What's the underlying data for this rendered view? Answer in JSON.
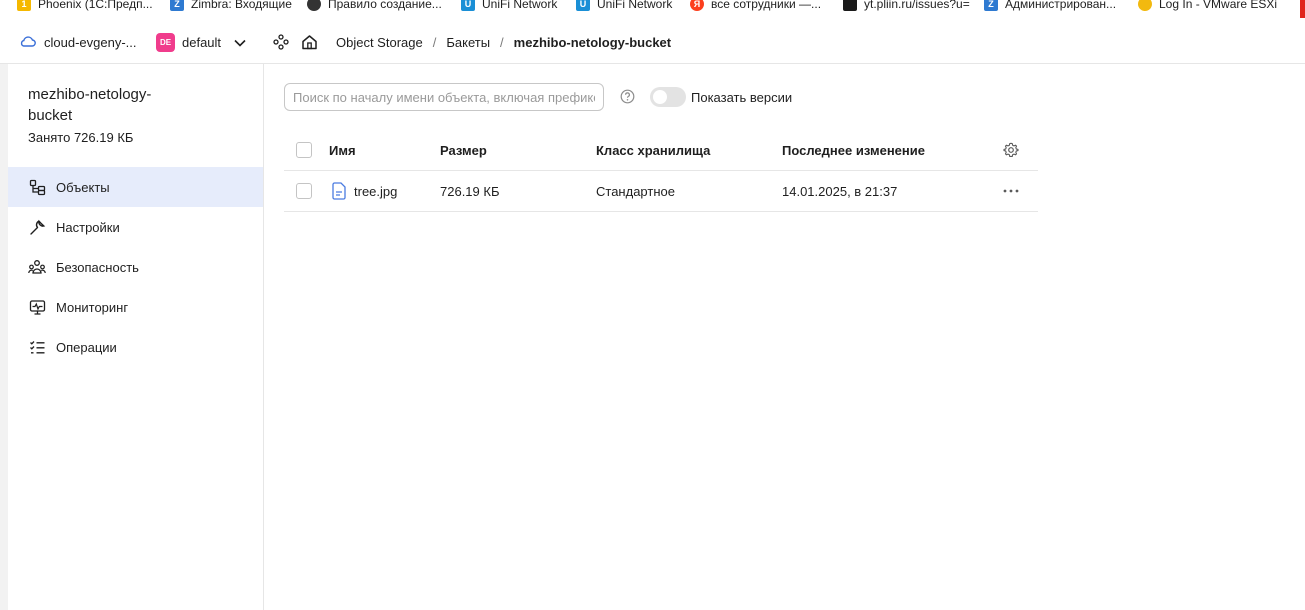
{
  "bookmarks": [
    {
      "label": "Phoenix (1С:Предп...",
      "icon": "1c-icon",
      "color": "#f5b800"
    },
    {
      "label": "Zimbra: Входящие",
      "icon": "zimbra-icon",
      "color": "#2e7ad1"
    },
    {
      "label": "Правило создание...",
      "icon": "globe-icon",
      "color": "#333333"
    },
    {
      "label": "UniFi Network",
      "icon": "unifi-icon",
      "color": "#1a8fd6"
    },
    {
      "label": "UniFi Network",
      "icon": "unifi-icon",
      "color": "#1a8fd6"
    },
    {
      "label": "все сотрудники —...",
      "icon": "yandex-icon",
      "color": "#fc3f1d"
    },
    {
      "label": "yt.pliin.ru/issues?u=",
      "icon": "youtrack-icon",
      "color": "#1a1a1a"
    },
    {
      "label": "Администрирован...",
      "icon": "zimbra-icon",
      "color": "#2e7ad1"
    },
    {
      "label": "Log In - VMware ESXi",
      "icon": "key-icon",
      "color": "#f2b90f"
    }
  ],
  "topbar": {
    "cloud": "cloud-evgeny-...",
    "folder_badge": "DE",
    "folder": "default",
    "breadcrumbs": [
      "Object Storage",
      "Бакеты",
      "mezhibo-netology-bucket"
    ]
  },
  "sidebar": {
    "bucket_name": "mezhibo-netology-bucket",
    "used": "Занято 726.19 КБ",
    "items": [
      {
        "label": "Объекты",
        "icon": "objects-icon",
        "active": true
      },
      {
        "label": "Настройки",
        "icon": "wrench-icon",
        "active": false
      },
      {
        "label": "Безопасность",
        "icon": "users-icon",
        "active": false
      },
      {
        "label": "Мониторинг",
        "icon": "monitor-icon",
        "active": false
      },
      {
        "label": "Операции",
        "icon": "operations-icon",
        "active": false
      }
    ]
  },
  "main": {
    "search_placeholder": "Поиск по началу имени объекта, включая префикс",
    "show_versions_label": "Показать версии",
    "show_versions": false,
    "table": {
      "columns": [
        "Имя",
        "Размер",
        "Класс хранилища",
        "Последнее изменение"
      ],
      "rows": [
        {
          "name": "tree.jpg",
          "size": "726.19 КБ",
          "storage_class": "Стандартное",
          "modified": "14.01.2025, в 21:37"
        }
      ]
    }
  },
  "colors": {
    "accent_active_bg": "#e6ecfb",
    "folder_badge": "#f03c8c"
  }
}
